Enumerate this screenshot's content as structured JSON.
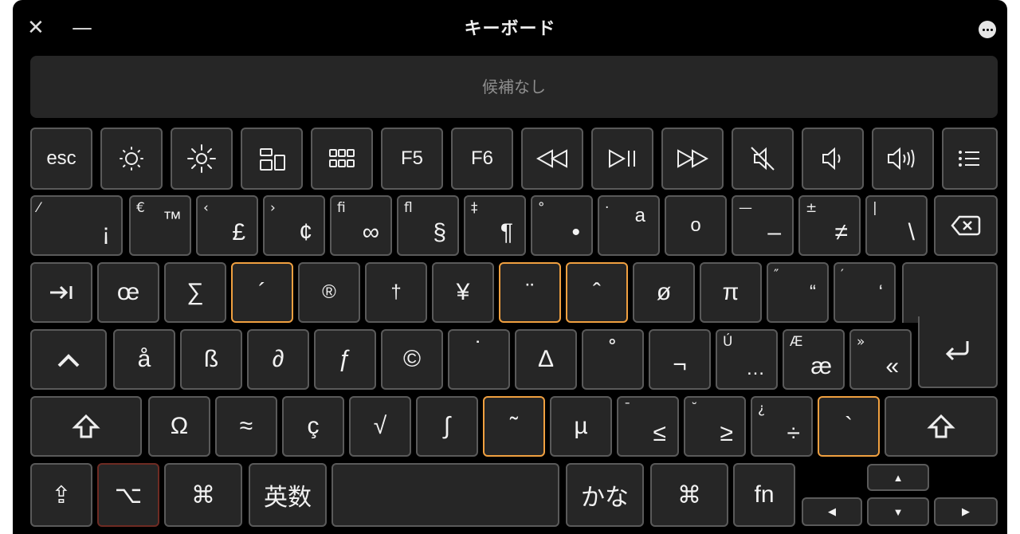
{
  "window": {
    "title": "キーボード",
    "close_glyph": "✕",
    "minimize_glyph": "—"
  },
  "candidate_bar": {
    "text": "候補なし"
  },
  "row1": {
    "esc": "esc",
    "f5": "F5",
    "f6": "F6",
    "icons": [
      "brightness-down-icon",
      "brightness-up-icon",
      "mission-control-icon",
      "launchpad-icon",
      "rewind-icon",
      "play-pause-icon",
      "fast-forward-icon",
      "mute-icon",
      "volume-down-icon",
      "volume-up-icon",
      "list-icon"
    ]
  },
  "row2": [
    {
      "name": "key-1",
      "shift": "⁄",
      "main": "¡"
    },
    {
      "name": "key-2",
      "shift": "€",
      "main": "™"
    },
    {
      "name": "key-3",
      "shift": "‹",
      "main": "£"
    },
    {
      "name": "key-4",
      "shift": "›",
      "main": "¢"
    },
    {
      "name": "key-5",
      "shift": "fi",
      "main": "∞"
    },
    {
      "name": "key-6",
      "shift": "fl",
      "main": "§"
    },
    {
      "name": "key-7",
      "shift": "‡",
      "main": "¶"
    },
    {
      "name": "key-8",
      "shift": "°",
      "main": "•"
    },
    {
      "name": "key-9",
      "shift": "·",
      "main": "a"
    },
    {
      "name": "key-0",
      "shift": "",
      "main": "o"
    },
    {
      "name": "key-minus",
      "shift": "—",
      "main": "–"
    },
    {
      "name": "key-equals",
      "shift": "±",
      "main": "≠"
    },
    {
      "name": "key-backslash",
      "shift": "|",
      "main": "\\"
    }
  ],
  "row3": [
    {
      "name": "key-q",
      "shift": "",
      "main": "œ"
    },
    {
      "name": "key-w",
      "shift": "",
      "main": "∑"
    },
    {
      "name": "key-e",
      "shift": "",
      "main": "´"
    },
    {
      "name": "key-r",
      "shift": "",
      "main": "®"
    },
    {
      "name": "key-t",
      "shift": "",
      "main": "†"
    },
    {
      "name": "key-y",
      "shift": "",
      "main": "¥"
    },
    {
      "name": "key-u",
      "shift": "",
      "main": "¨"
    },
    {
      "name": "key-i",
      "shift": "",
      "main": "ˆ"
    },
    {
      "name": "key-o",
      "shift": "",
      "main": "ø"
    },
    {
      "name": "key-p",
      "shift": "",
      "main": "π"
    },
    {
      "name": "key-bracket-left",
      "shift": "″",
      "main": "“"
    },
    {
      "name": "key-bracket-right",
      "shift": "′",
      "main": "‘"
    }
  ],
  "row4": [
    {
      "name": "key-a",
      "shift": "",
      "main": "å"
    },
    {
      "name": "key-s",
      "shift": "",
      "main": "ß"
    },
    {
      "name": "key-d",
      "shift": "",
      "main": "∂"
    },
    {
      "name": "key-f",
      "shift": "",
      "main": "ƒ"
    },
    {
      "name": "key-g",
      "shift": "",
      "main": "©"
    },
    {
      "name": "key-h",
      "shift": "",
      "main": "˙"
    },
    {
      "name": "key-j",
      "shift": "",
      "main": "∆"
    },
    {
      "name": "key-k",
      "shift": "",
      "main": "˚"
    },
    {
      "name": "key-l",
      "shift": "",
      "main": "¬"
    },
    {
      "name": "key-semicolon",
      "shift": "Ú",
      "main": "…"
    },
    {
      "name": "key-quote",
      "shift": "Æ",
      "main": "æ"
    },
    {
      "name": "key-close-bracket",
      "shift": "»",
      "main": "«"
    }
  ],
  "row5": [
    {
      "name": "key-z",
      "shift": "",
      "main": "Ω"
    },
    {
      "name": "key-x",
      "shift": "",
      "main": "≈"
    },
    {
      "name": "key-c",
      "shift": "",
      "main": "ç"
    },
    {
      "name": "key-v",
      "shift": "",
      "main": "√"
    },
    {
      "name": "key-b",
      "shift": "",
      "main": "∫"
    },
    {
      "name": "key-n",
      "shift": "",
      "main": "˜"
    },
    {
      "name": "key-m",
      "shift": "",
      "main": "µ"
    },
    {
      "name": "key-comma",
      "shift": "¯",
      "main": "≤"
    },
    {
      "name": "key-period",
      "shift": "˘",
      "main": "≥"
    },
    {
      "name": "key-slash",
      "shift": "¿",
      "main": "÷"
    },
    {
      "name": "key-underscore",
      "shift": "",
      "main": "`"
    }
  ],
  "row6": {
    "eisu": "英数",
    "kana": "かな",
    "fn": "fn",
    "command_glyph": "⌘",
    "option_glyph": "⌥",
    "caps_glyph": "⇪"
  },
  "colors": {
    "selected_border": "#f0a040",
    "held_border": "#6e2b23",
    "key_bg": "#262626"
  }
}
